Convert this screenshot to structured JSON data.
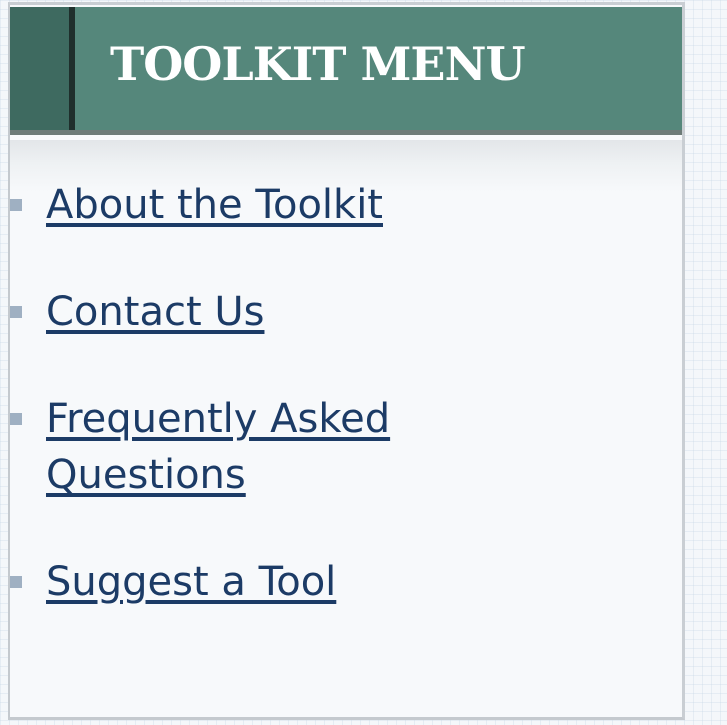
{
  "menu": {
    "title": "TOOLKIT MENU",
    "items": [
      {
        "label": "About the Toolkit"
      },
      {
        "label": "Contact Us"
      },
      {
        "label": "Frequently Asked Questions"
      },
      {
        "label": "Suggest a Tool"
      }
    ]
  },
  "colors": {
    "header_bg": "#55877b",
    "header_accent": "#3e6a60",
    "link": "#1c3b66",
    "bullet": "#9fb0c2"
  }
}
